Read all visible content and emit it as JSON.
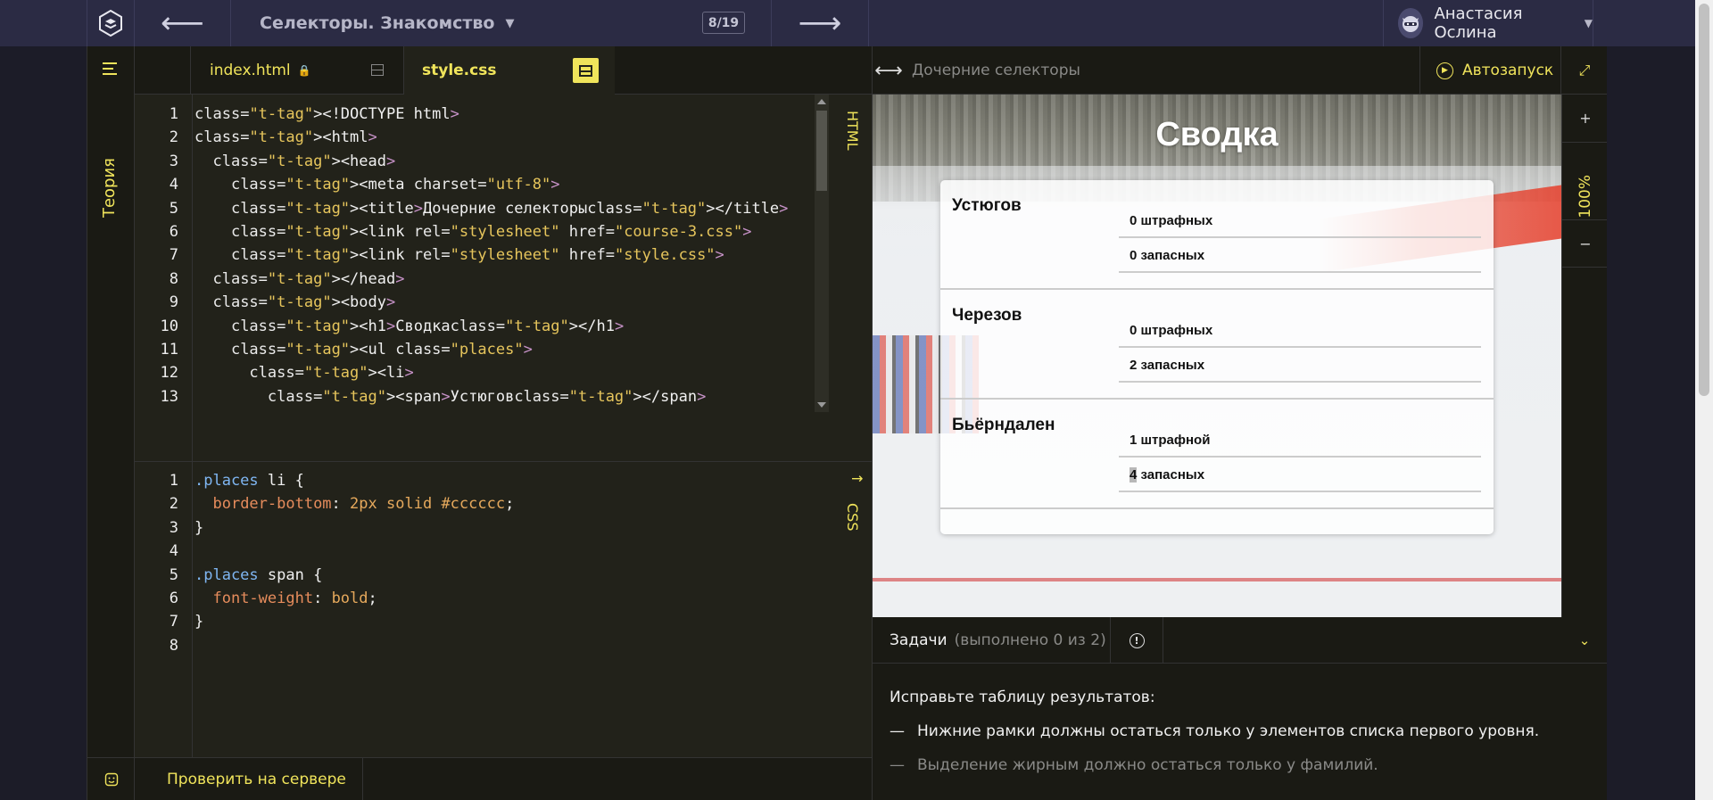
{
  "topbar": {
    "course_title": "Селекторы. Знакомство",
    "counter": "8/19",
    "user_name": "Анастасия Ослина"
  },
  "sidebar": {
    "theory_label": "Теория"
  },
  "editor": {
    "tabs": [
      {
        "label": "index.html",
        "locked": true
      },
      {
        "label": "style.css",
        "active": true
      }
    ],
    "html_label": "HTML",
    "css_label": "CSS",
    "html_lines": [
      "<!DOCTYPE html>",
      "<html>",
      "  <head>",
      "    <meta charset=\"utf-8\">",
      "    <title>Дочерние селекторы</title>",
      "    <link rel=\"stylesheet\" href=\"course-3.css\">",
      "    <link rel=\"stylesheet\" href=\"style.css\">",
      "  </head>",
      "  <body>",
      "    <h1>Сводка</h1>",
      "    <ul class=\"places\">",
      "      <li>",
      "        <span>Устюгов</span>"
    ],
    "css_lines": [
      ".places li {",
      "  border-bottom: 2px solid #cccccc;",
      "}",
      "",
      ".places span {",
      "  font-weight: bold;",
      "}",
      ""
    ],
    "check_button": "Проверить на сервере"
  },
  "preview": {
    "title": "Дочерние селекторы",
    "autorun_label": "Автозапуск",
    "zoom": "100%",
    "page": {
      "heading": "Сводка",
      "places": [
        {
          "name": "Устюгов",
          "stats": [
            "0 штрафных",
            "0 запасных"
          ]
        },
        {
          "name": "Черезов",
          "stats": [
            "0 штрафных",
            "2 запасных"
          ]
        },
        {
          "name": "Бьёрндален",
          "stats": [
            "1 штрафной",
            "4 запасных"
          ]
        }
      ]
    }
  },
  "tasks": {
    "title": "Задачи",
    "progress": "(выполнено 0 из 2)",
    "intro": "Исправьте таблицу результатов:",
    "items": [
      {
        "dash": "—",
        "text": "Нижние рамки должны остаться только у элементов списка первого уровня."
      },
      {
        "dash": "—",
        "text": "Выделение жирным должно остаться только у фамилий."
      }
    ]
  },
  "colors": {
    "accent": "#f0e45b",
    "topbar": "#2b2b44",
    "editor_bg": "#22221a"
  }
}
